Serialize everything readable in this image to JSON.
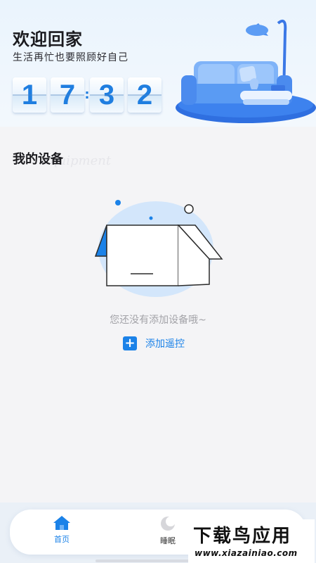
{
  "header": {
    "title": "欢迎回家",
    "subtitle": "生活再忙也要照顾好自己",
    "clock": {
      "h1": "1",
      "h2": "7",
      "separator": ":",
      "m1": "3",
      "m2": "2"
    }
  },
  "devices": {
    "section_title": "我的设备",
    "section_ghost": "Equipment",
    "empty_text": "您还没有添加设备哦~",
    "add_icon": "+",
    "add_label": "添加遥控"
  },
  "nav": {
    "items": [
      {
        "label": "首页",
        "icon": "home-icon",
        "active": true
      },
      {
        "label": "睡眠",
        "icon": "moon-icon",
        "active": false
      }
    ]
  },
  "watermark": {
    "main": "下载鸟应用",
    "sub": "www.xiazainiao.com"
  },
  "colors": {
    "accent": "#1b82e8",
    "digit": "#1f7ee0",
    "background": "#f4f4f6"
  }
}
